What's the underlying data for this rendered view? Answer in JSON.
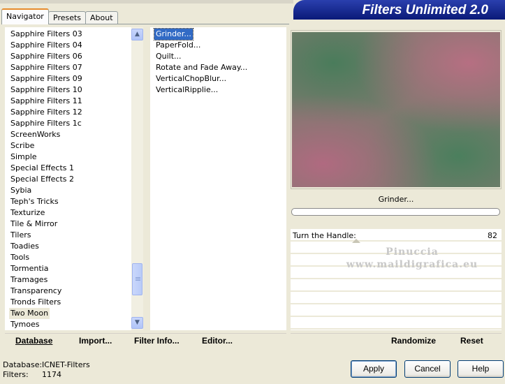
{
  "window": {
    "title": "Filters Unlimited 2.0"
  },
  "tabs": [
    {
      "label": "Navigator",
      "active": true
    },
    {
      "label": "Presets",
      "active": false
    },
    {
      "label": "About",
      "active": false
    }
  ],
  "categories": {
    "items": [
      "Sapphire Filters 03",
      "Sapphire Filters 04",
      "Sapphire Filters 06",
      "Sapphire Filters 07",
      "Sapphire Filters 09",
      "Sapphire Filters 10",
      "Sapphire Filters 11",
      "Sapphire Filters 12",
      "Sapphire Filters 1c",
      "ScreenWorks",
      "Scribe",
      "Simple",
      "Special Effects 1",
      "Special Effects 2",
      "Sybia",
      "Teph's Tricks",
      "Texturize",
      "Tile & Mirror",
      "Tilers",
      "Toadies",
      "Tools",
      "Tormentia",
      "Tramages",
      "Transparency",
      "Tronds Filters",
      "Two Moon",
      "Tymoes"
    ],
    "selected": "Two Moon"
  },
  "filters": {
    "items": [
      "Grinder...",
      "PaperFold...",
      "Quilt...",
      "Rotate and Fade Away...",
      "VerticalChopBlur...",
      "VerticalRipplie..."
    ],
    "selected": "Grinder..."
  },
  "preview": {
    "filter_name": "Grinder..."
  },
  "params": [
    {
      "label": "Turn the Handle:",
      "value": "82"
    }
  ],
  "watermark": {
    "line1": "Pinuccia",
    "line2": "www.maildigrafica.eu"
  },
  "actions": {
    "database": "Database",
    "import": "Import...",
    "filter_info": "Filter Info...",
    "editor": "Editor...",
    "randomize": "Randomize",
    "reset": "Reset"
  },
  "footer": {
    "database_label": "Database:",
    "database_value": "ICNET-Filters",
    "filters_label": "Filters:",
    "filters_value": "1174"
  },
  "buttons": {
    "apply": "Apply",
    "cancel": "Cancel",
    "help": "Help"
  }
}
